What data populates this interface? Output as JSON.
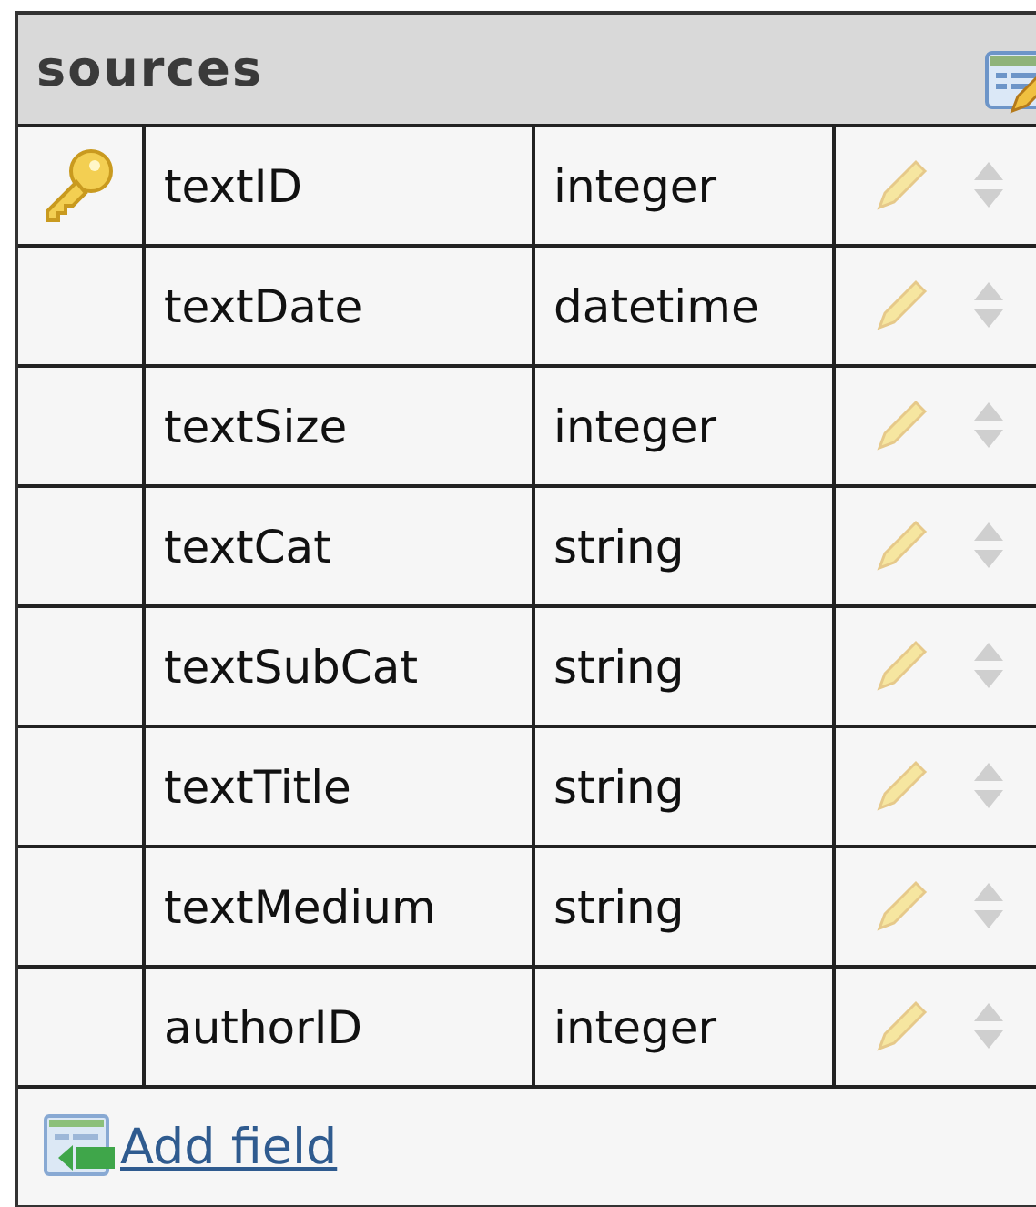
{
  "table": {
    "title": "sources",
    "fields": [
      {
        "name": "textID",
        "type": "integer",
        "primary_key": true
      },
      {
        "name": "textDate",
        "type": "datetime",
        "primary_key": false
      },
      {
        "name": "textSize",
        "type": "integer",
        "primary_key": false
      },
      {
        "name": "textCat",
        "type": "string",
        "primary_key": false
      },
      {
        "name": "textSubCat",
        "type": "string",
        "primary_key": false
      },
      {
        "name": "textTitle",
        "type": "string",
        "primary_key": false
      },
      {
        "name": "textMedium",
        "type": "string",
        "primary_key": false
      },
      {
        "name": "authorID",
        "type": "integer",
        "primary_key": false
      }
    ],
    "add_link": "Add field"
  }
}
